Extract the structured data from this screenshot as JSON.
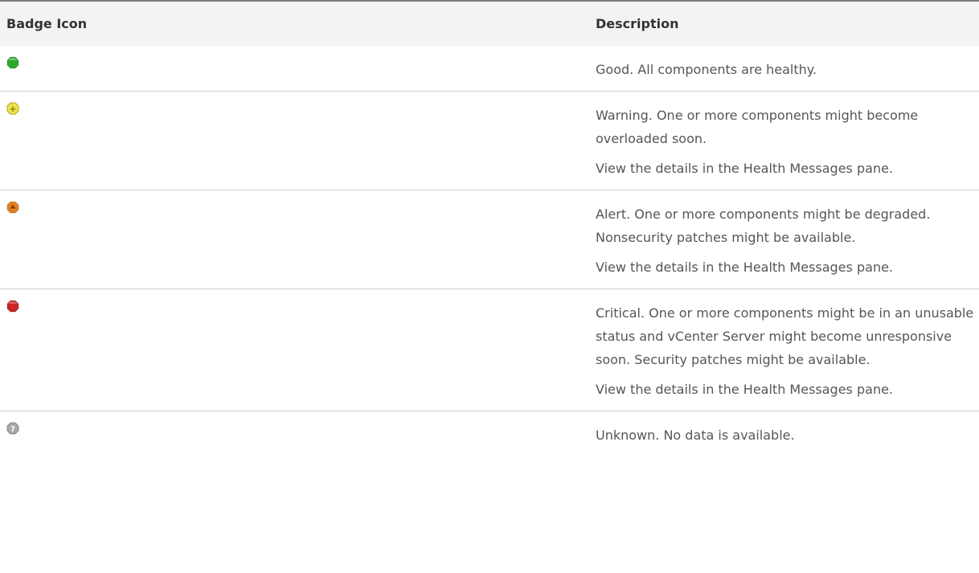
{
  "table": {
    "headers": {
      "icon": "Badge Icon",
      "description": "Description"
    },
    "rows": [
      {
        "icon": "green-health-badge-icon",
        "color": "#2da82d",
        "symbol": "",
        "paragraphs": [
          "Good. All components are healthy."
        ]
      },
      {
        "icon": "yellow-warning-badge-icon",
        "color": "#ede54b",
        "symbol": "+",
        "paragraphs": [
          "Warning. One or more components might become overloaded soon.",
          "View the details in the Health Messages pane."
        ]
      },
      {
        "icon": "orange-alert-badge-icon",
        "color": "#e4801c",
        "symbol": "▲",
        "paragraphs": [
          "Alert. One or more components might be degraded. Nonsecurity patches might be available.",
          "View the details in the Health Messages pane."
        ]
      },
      {
        "icon": "red-critical-badge-icon",
        "color": "#cc2424",
        "symbol": "",
        "paragraphs": [
          "Critical. One or more components might be in an unusable status and vCenter Server might become unresponsive soon. Security patches might be available.",
          "View the details in the Health Messages pane."
        ]
      },
      {
        "icon": "gray-unknown-badge-icon",
        "color": "#a8a8a8",
        "symbol": "?",
        "paragraphs": [
          "Unknown. No data is available."
        ]
      }
    ]
  }
}
